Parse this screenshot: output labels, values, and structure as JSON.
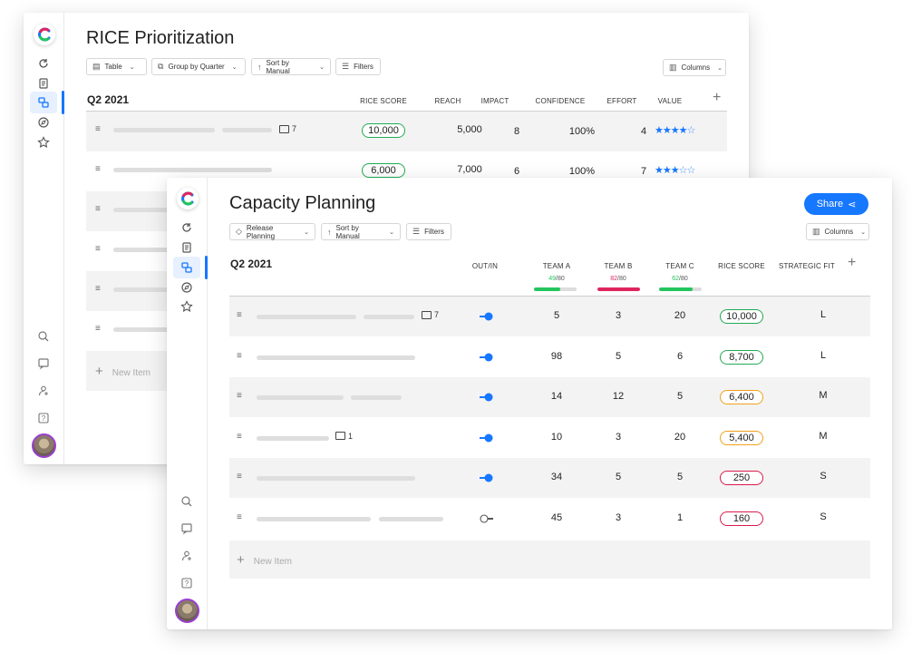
{
  "rice": {
    "title": "RICE Prioritization",
    "controls": {
      "table": "Table",
      "group": "Group by Quarter",
      "sort": "Sort by Manual",
      "filters": "Filters",
      "columns": "Columns"
    },
    "group_title": "Q2 2021",
    "columns": [
      "RICE SCORE",
      "REACH",
      "IMPACT",
      "CONFIDENCE",
      "EFFORT",
      "VALUE"
    ],
    "rows": [
      {
        "image_count": "7",
        "rice": "10,000",
        "reach": "5,000",
        "impact": "8",
        "confidence": "100%",
        "effort": "4",
        "stars": 4
      },
      {
        "image_count": "",
        "rice": "6,000",
        "reach": "7,000",
        "impact": "6",
        "confidence": "100%",
        "effort": "7",
        "stars": 3
      }
    ],
    "new_item": "New Item"
  },
  "capacity": {
    "title": "Capacity Planning",
    "share_label": "Share",
    "controls": {
      "release": "Release Planning",
      "sort": "Sort by Manual",
      "filters": "Filters",
      "columns": "Columns"
    },
    "group_title": "Q2 2021",
    "columns": [
      "OUT/IN",
      "TEAM A",
      "TEAM B",
      "TEAM C",
      "RICE SCORE",
      "STRATEGIC FIT"
    ],
    "teams": [
      {
        "used": "49",
        "total": "/80",
        "fraction": 0.61,
        "color": "#22c55e"
      },
      {
        "used": "82",
        "total": "/80",
        "fraction": 1.0,
        "color": "#e0245e"
      },
      {
        "used": "62",
        "total": "/80",
        "fraction": 0.78,
        "color": "#22c55e"
      }
    ],
    "rows": [
      {
        "image_count": "7",
        "in": true,
        "a": "5",
        "b": "3",
        "c": "20",
        "rice": "10,000",
        "rice_color": "#22aa55",
        "fit": "L"
      },
      {
        "image_count": "",
        "in": true,
        "a": "98",
        "b": "5",
        "c": "6",
        "rice": "8,700",
        "rice_color": "#22aa55",
        "fit": "L"
      },
      {
        "image_count": "",
        "in": true,
        "a": "14",
        "b": "12",
        "c": "5",
        "rice": "6,400",
        "rice_color": "#f0a020",
        "fit": "M"
      },
      {
        "image_count": "1",
        "in": true,
        "a": "10",
        "b": "3",
        "c": "20",
        "rice": "5,400",
        "rice_color": "#f0a020",
        "fit": "M"
      },
      {
        "image_count": "",
        "in": true,
        "a": "34",
        "b": "5",
        "c": "5",
        "rice": "250",
        "rice_color": "#d81b4a",
        "fit": "S"
      },
      {
        "image_count": "",
        "in": false,
        "a": "45",
        "b": "3",
        "c": "1",
        "rice": "160",
        "rice_color": "#d81b4a",
        "fit": "S"
      }
    ],
    "new_item": "New Item"
  },
  "colors": {
    "accent": "#1677ff"
  }
}
